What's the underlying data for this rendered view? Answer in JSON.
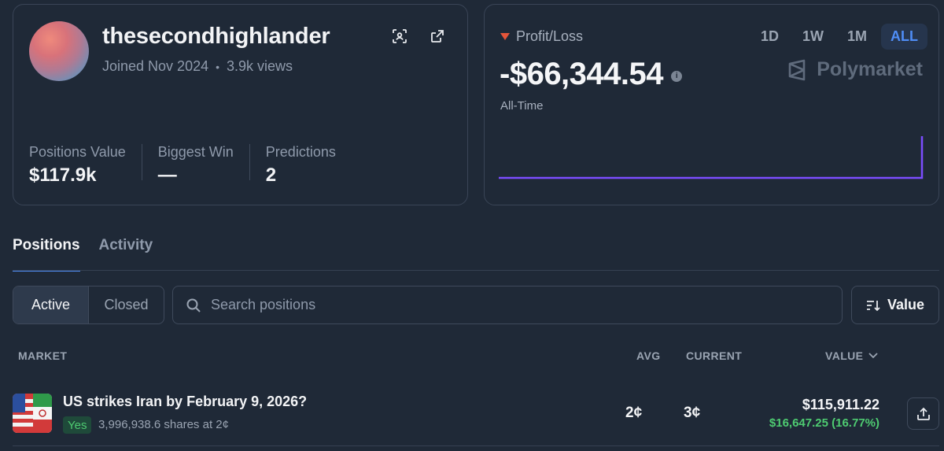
{
  "profile": {
    "username": "thesecondhighlander",
    "joined": "Joined Nov 2024",
    "separator": "•",
    "views": "3.9k views",
    "icons": [
      "scan-icon",
      "external-link-icon"
    ],
    "stats": [
      {
        "label": "Positions Value",
        "value": "$117.9k"
      },
      {
        "label": "Biggest Win",
        "value": "—"
      },
      {
        "label": "Predictions",
        "value": "2"
      }
    ]
  },
  "pnl": {
    "label": "Profit/Loss",
    "value": "-$66,344.54",
    "period": "All-Time",
    "brand": "Polymarket",
    "ranges": [
      "1D",
      "1W",
      "1M",
      "ALL"
    ],
    "active_range": "ALL",
    "line_color": "#7c4dff",
    "down_color": "#e5553a"
  },
  "tabs": [
    "Positions",
    "Activity"
  ],
  "filters": {
    "active_label": "Active",
    "closed_label": "Closed",
    "search_placeholder": "Search positions",
    "sort_label": "Value"
  },
  "table": {
    "headers": {
      "market": "MARKET",
      "avg": "AVG",
      "current": "CURRENT",
      "value": "VALUE"
    },
    "rows": [
      {
        "title": "US strikes Iran by February 9, 2026?",
        "outcome": "Yes",
        "shares": "3,996,938.6 shares at 2¢",
        "avg": "2¢",
        "current": "3¢",
        "value": "$115,911.22",
        "pnl": "$16,647.25 (16.77%)"
      }
    ]
  },
  "colors": {
    "accent": "#4f8df6",
    "positive": "#4ecb71",
    "background": "#1f2937"
  }
}
